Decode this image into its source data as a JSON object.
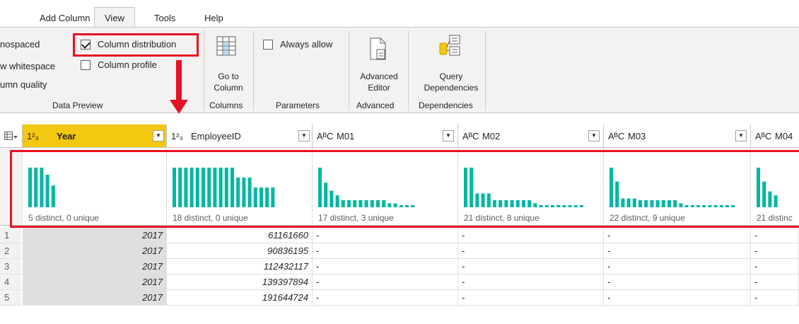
{
  "tabs": [
    "Add Column",
    "View",
    "Tools",
    "Help"
  ],
  "ribbon": {
    "data_preview": {
      "monospaced": "nospaced",
      "whitespace": "w whitespace",
      "column_quality": "umn quality",
      "column_distribution": "Column distribution",
      "column_profile": "Column profile",
      "group": "Data Preview"
    },
    "columns": {
      "go_to_column": "Go to\nColumn",
      "group": "Columns"
    },
    "parameters": {
      "always_allow": "Always allow",
      "group": "Parameters"
    },
    "advanced": {
      "advanced_editor": "Advanced\nEditor",
      "group": "Advanced"
    },
    "dependencies": {
      "query_dependencies": "Query\nDependencies",
      "group": "Dependencies"
    }
  },
  "colors": {
    "accent": "#f2c811",
    "bar": "#00b7a2",
    "highlight": "#e81123"
  },
  "grid": {
    "columns": [
      {
        "type": "1²₃",
        "name": "Year",
        "distinct": "5 distinct, 0 unique",
        "bars": [
          1,
          1,
          1,
          0.82,
          0.55
        ]
      },
      {
        "type": "1²₃",
        "name": "EmployeeID",
        "distinct": "18 distinct, 0 unique",
        "bars": [
          1,
          1,
          1,
          1,
          1,
          1,
          1,
          1,
          1,
          1,
          1,
          0.75,
          0.75,
          0.75,
          0.5,
          0.5,
          0.5,
          0.5
        ]
      },
      {
        "type": "AᴮC",
        "name": "M01",
        "distinct": "17 distinct, 3 unique",
        "bars": [
          1,
          0.62,
          0.42,
          0.3,
          0.18,
          0.18,
          0.18,
          0.18,
          0.18,
          0.18,
          0.18,
          0.18,
          0.1,
          0.1,
          0.05,
          0.05,
          0.05
        ]
      },
      {
        "type": "AᴮC",
        "name": "M02",
        "distinct": "21 distinct, 8 unique",
        "bars": [
          1,
          1,
          0.35,
          0.35,
          0.35,
          0.18,
          0.18,
          0.18,
          0.18,
          0.18,
          0.18,
          0.18,
          0.1,
          0.05,
          0.05,
          0.05,
          0.05,
          0.05,
          0.05,
          0.05,
          0.05
        ]
      },
      {
        "type": "AᴮC",
        "name": "M03",
        "distinct": "22 distinct, 9 unique",
        "bars": [
          1,
          0.65,
          0.22,
          0.22,
          0.22,
          0.18,
          0.18,
          0.18,
          0.18,
          0.18,
          0.18,
          0.18,
          0.1,
          0.05,
          0.05,
          0.05,
          0.05,
          0.05,
          0.05,
          0.05,
          0.05,
          0.05
        ]
      },
      {
        "type": "AᴮC",
        "name": "M04",
        "distinct": "21 distinc",
        "bars": [
          1,
          0.65,
          0.4,
          0.3
        ]
      }
    ],
    "rows": [
      {
        "num": "1",
        "year": "2017",
        "emp": "61161660",
        "m01": "-",
        "m02": "-",
        "m03": "-",
        "m04": "-"
      },
      {
        "num": "2",
        "year": "2017",
        "emp": "90836195",
        "m01": "-",
        "m02": "-",
        "m03": "-",
        "m04": "-"
      },
      {
        "num": "3",
        "year": "2017",
        "emp": "112432117",
        "m01": "-",
        "m02": "-",
        "m03": "-",
        "m04": "-"
      },
      {
        "num": "4",
        "year": "2017",
        "emp": "139397894",
        "m01": "-",
        "m02": "-",
        "m03": "-",
        "m04": "-"
      },
      {
        "num": "5",
        "year": "2017",
        "emp": "191644724",
        "m01": "-",
        "m02": "-",
        "m03": "-",
        "m04": "-"
      }
    ]
  }
}
